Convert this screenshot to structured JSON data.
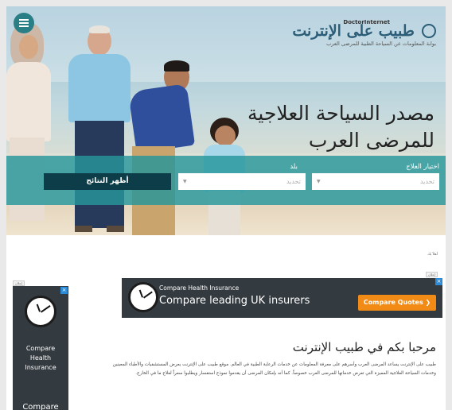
{
  "header": {
    "brand_en": "DoctorInternet",
    "brand_ar": "طبيب على الإنترنت",
    "tagline": "بوابة المعلومات عن السياحة الطبية للمرضى العرب",
    "headline_line1": "مصدر السياحة العلاجية",
    "headline_line2": "للمرضى العرب"
  },
  "search": {
    "treatment_label": "اختيار العلاج",
    "country_label": "بلد",
    "treatment_placeholder": "تحديد",
    "country_placeholder": "تحديد",
    "submit_label": "أظهر النتائج"
  },
  "breadcrumb": "أهلاً بك",
  "ads": {
    "badge": "إعلان",
    "close": "×",
    "side_text_line1": "Compare",
    "side_text_line2": "Health",
    "side_text_line3": "Insurance",
    "side_text_bottom": "Compare",
    "banner_small": "Compare Health Insurance",
    "banner_big": "Compare leading UK insurers",
    "banner_button": "Compare Quotes ❯"
  },
  "welcome": {
    "title": "مرحبا بكم في طبيب الإنترنت",
    "body": "طبيب على الإنترنت يساعد المرضى العرب وأسرهم على معرفة المعلومات عن خدمات الرعاية الطبية في العالم. موقع طبيب على الإنترنت يعرض المستشفيات والأطباء المعينين وخدمات السياحة العلاجية المميزة التي تعرض خدماتها للمرضى العرب خصوصاً. كما أنه بإمكان المرضى أن يقدموا نموذج استفسار ويطلبوا سعراً لعلاج ما في الخارج."
  },
  "colors": {
    "teal_band": "#26969b",
    "dark_button": "#0c3d48",
    "brand_blue": "#2b5d78",
    "ad_bg": "#333a40",
    "ad_button": "#f28a16"
  }
}
